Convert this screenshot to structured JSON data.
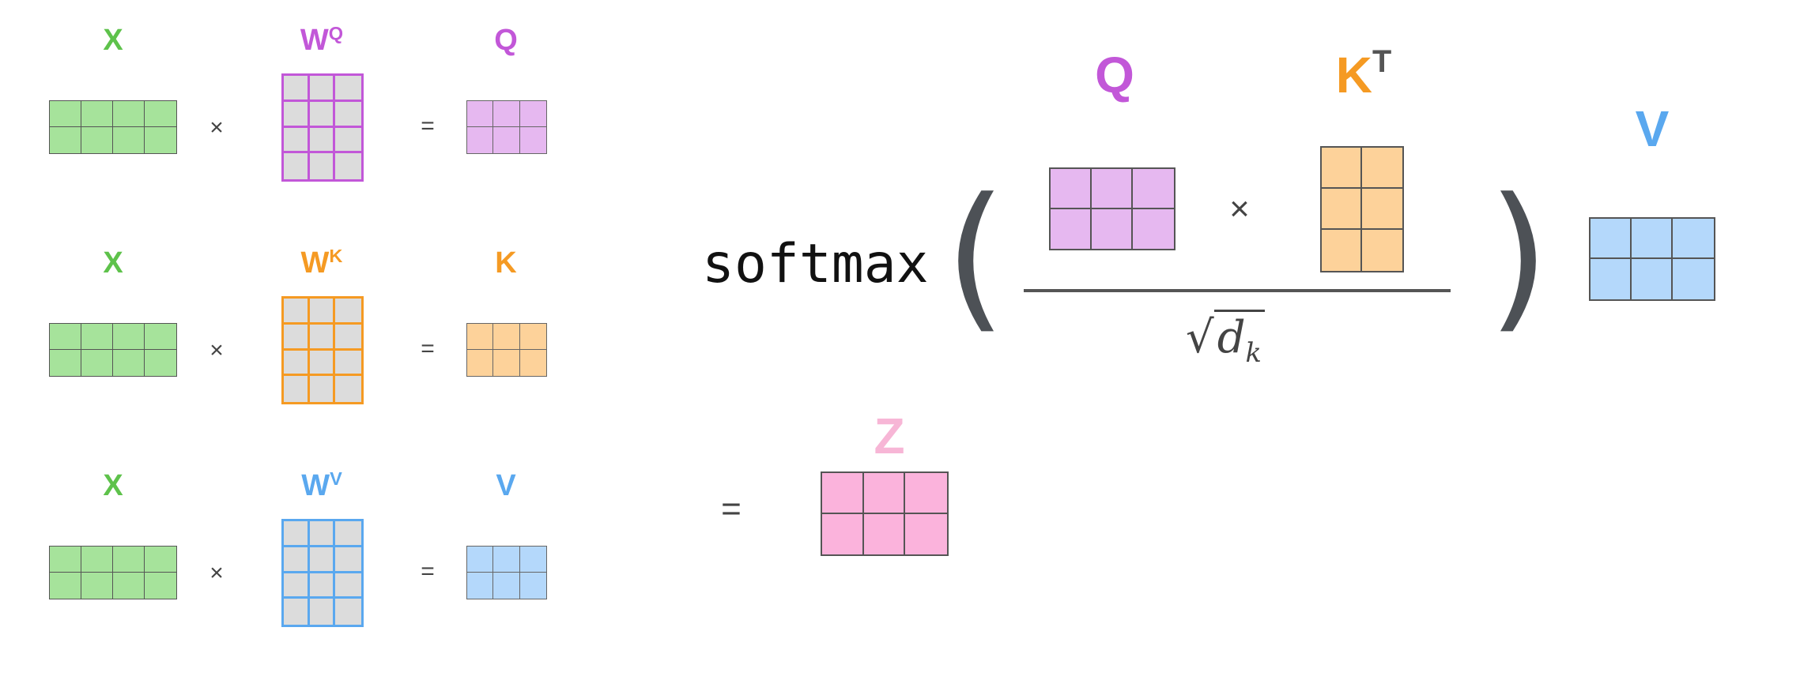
{
  "colors": {
    "green": "#5ec24b",
    "purple": "#c257d8",
    "orange": "#f59a23",
    "blue": "#5aa8ef",
    "pink": "#f7b6d6",
    "dark": "#444444"
  },
  "projections": [
    {
      "input": "X",
      "weight_base": "W",
      "weight_sup": "Q",
      "output": "Q",
      "times": "×",
      "equals": "="
    },
    {
      "input": "X",
      "weight_base": "W",
      "weight_sup": "K",
      "output": "K",
      "times": "×",
      "equals": "="
    },
    {
      "input": "X",
      "weight_base": "W",
      "weight_sup": "V",
      "output": "V",
      "times": "×",
      "equals": "="
    }
  ],
  "formula": {
    "function": "softmax",
    "open_paren": "(",
    "close_paren": ")",
    "q_label": "Q",
    "k_label": "K",
    "k_sup": "T",
    "times": "×",
    "denominator_root": "√",
    "denominator_var": "d",
    "denominator_sub": "k",
    "v_label": "V",
    "equals": "=",
    "z_label": "Z"
  }
}
